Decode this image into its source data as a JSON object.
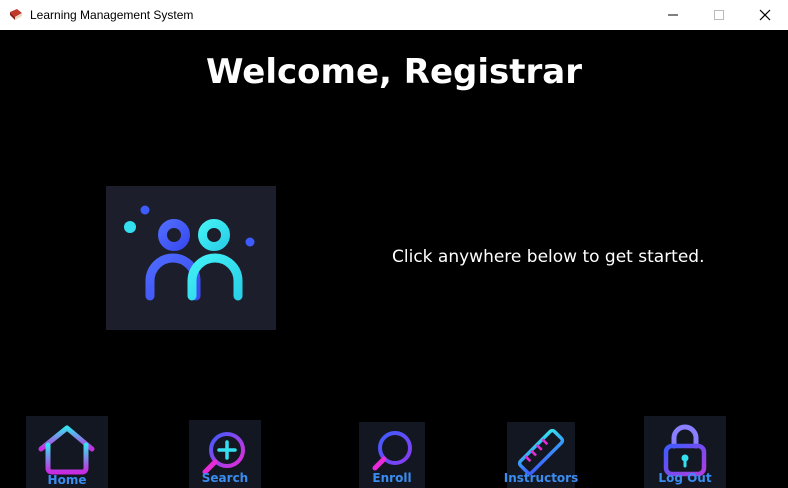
{
  "window": {
    "title": "Learning Management System"
  },
  "main": {
    "welcome": "Welcome, Registrar",
    "prompt": "Click anywhere below to get started."
  },
  "nav": {
    "home": "Home",
    "search": "Search",
    "enroll": "Enroll",
    "instructors": "Instructors",
    "logout": "Log Out"
  },
  "colors": {
    "background": "#000000",
    "label_blue": "#3a8cf0",
    "hero_bg": "#1c1f2b",
    "icon_cyan": "#34e0f0",
    "icon_blue": "#3d5cff",
    "icon_magenta": "#e72bd7"
  }
}
